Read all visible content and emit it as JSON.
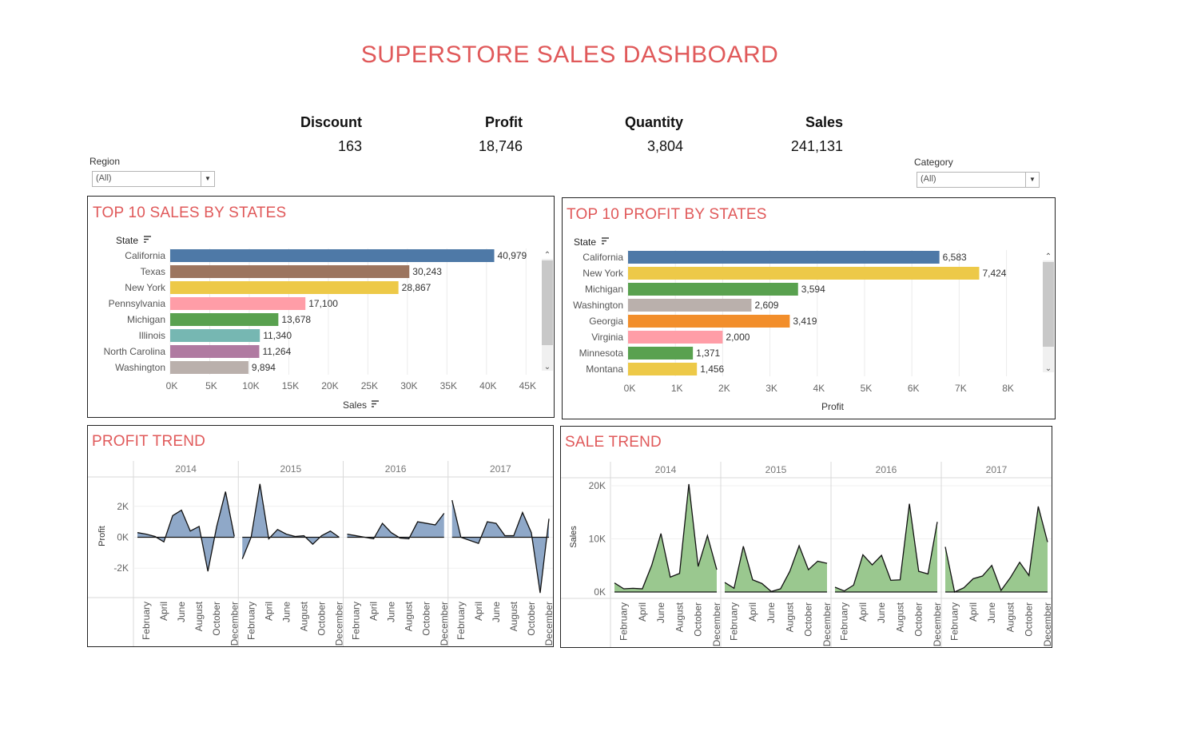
{
  "dashboard": {
    "title": "SUPERSTORE SALES DASHBOARD"
  },
  "kpis": [
    {
      "label": "Discount",
      "value": "163"
    },
    {
      "label": "Profit",
      "value": "18,746"
    },
    {
      "label": "Quantity",
      "value": "3,804"
    },
    {
      "label": "Sales",
      "value": "241,131"
    }
  ],
  "filters": {
    "region": {
      "label": "Region",
      "value": "(All)"
    },
    "category": {
      "label": "Category",
      "value": "(All)"
    }
  },
  "panels": {
    "top_sales": {
      "title": "TOP 10 SALES BY STATES",
      "row_header": "State",
      "axis_title": "Sales"
    },
    "top_profit": {
      "title": "TOP 10 PROFIT BY STATES",
      "row_header": "State",
      "axis_title": "Profit"
    },
    "profit_trend": {
      "title": "PROFIT TREND",
      "axis_title": "Profit"
    },
    "sale_trend": {
      "title": "SALE TREND",
      "axis_title": "Sales"
    }
  },
  "colors": {
    "title": "#e0595a",
    "profit_area": "#8fa8c8",
    "sales_area": "#9ac88f"
  },
  "chart_data": [
    {
      "id": "top_sales",
      "type": "bar",
      "orientation": "horizontal",
      "categories": [
        "California",
        "Texas",
        "New York",
        "Pennsylvania",
        "Michigan",
        "Illinois",
        "North Carolina",
        "Washington"
      ],
      "values": [
        40979,
        30243,
        28867,
        17100,
        13678,
        11340,
        11264,
        9894
      ],
      "labels": [
        "40,979",
        "30,243",
        "28,867",
        "17,100",
        "13,678",
        "11,340",
        "11,264",
        "9,894"
      ],
      "colors": [
        "#4e79a7",
        "#9c755f",
        "#edc948",
        "#ff9da7",
        "#59a14f",
        "#76b7b2",
        "#b07aa1",
        "#bab0ac"
      ],
      "xlabel": "Sales",
      "xlim": [
        0,
        48000
      ],
      "ticks": [
        0,
        5000,
        10000,
        15000,
        20000,
        25000,
        30000,
        35000,
        40000,
        45000
      ],
      "tick_labels": [
        "0K",
        "5K",
        "10K",
        "15K",
        "20K",
        "25K",
        "30K",
        "35K",
        "40K",
        "45K"
      ],
      "grid": true
    },
    {
      "id": "top_profit",
      "type": "bar",
      "orientation": "horizontal",
      "categories": [
        "California",
        "New York",
        "Michigan",
        "Washington",
        "Georgia",
        "Virginia",
        "Minnesota",
        "Montana"
      ],
      "values": [
        6583,
        7424,
        3594,
        2609,
        3419,
        2000,
        1371,
        1456
      ],
      "labels": [
        "6,583",
        "7,424",
        "3,594",
        "2,609",
        "3,419",
        "2,000",
        "1,371",
        "1,456"
      ],
      "colors": [
        "#4e79a7",
        "#edc948",
        "#59a14f",
        "#bab0ac",
        "#f28e2b",
        "#ff9da7",
        "#59a14f",
        "#edc948"
      ],
      "xlabel": "Profit",
      "xlim": [
        0,
        8700
      ],
      "ticks": [
        0,
        1000,
        2000,
        3000,
        4000,
        5000,
        6000,
        7000,
        8000
      ],
      "tick_labels": [
        "0K",
        "1K",
        "2K",
        "3K",
        "4K",
        "5K",
        "6K",
        "7K",
        "8K"
      ],
      "grid": true
    },
    {
      "id": "profit_trend",
      "type": "area",
      "years": [
        "2014",
        "2015",
        "2016",
        "2017"
      ],
      "months_shown": [
        "February",
        "April",
        "June",
        "August",
        "October",
        "December"
      ],
      "ylabel": "Profit",
      "ylim": [
        -3900,
        3900
      ],
      "yticks": [
        -2000,
        0,
        2000
      ],
      "ytick_labels": [
        "-2K",
        "0K",
        "2K"
      ],
      "series": [
        [
          300,
          200,
          50,
          -300,
          1400,
          1750,
          400,
          700,
          -2200,
          700,
          2950,
          50
        ],
        [
          -1400,
          0,
          3450,
          -100,
          500,
          200,
          50,
          100,
          -450,
          100,
          400,
          0
        ],
        [
          200,
          100,
          0,
          -100,
          900,
          300,
          -50,
          -100,
          1000,
          900,
          800,
          1550
        ],
        [
          2400,
          0,
          -200,
          -400,
          1000,
          900,
          100,
          100,
          1600,
          300,
          -3600,
          1200
        ]
      ]
    },
    {
      "id": "sale_trend",
      "type": "area",
      "years": [
        "2014",
        "2015",
        "2016",
        "2017"
      ],
      "months_shown": [
        "February",
        "April",
        "June",
        "August",
        "October",
        "December"
      ],
      "ylabel": "Sales",
      "ylim": [
        -1200,
        21500
      ],
      "yticks": [
        0,
        10000,
        20000
      ],
      "ytick_labels": [
        "0K",
        "10K",
        "20K"
      ],
      "series": [
        [
          1700,
          600,
          700,
          600,
          5000,
          11000,
          2800,
          3500,
          20300,
          4800,
          10600,
          4200
        ],
        [
          1800,
          700,
          8600,
          2300,
          1600,
          100,
          600,
          3900,
          8700,
          4200,
          5800,
          5400
        ],
        [
          900,
          200,
          1300,
          7000,
          5100,
          6900,
          2200,
          2300,
          16600,
          3900,
          3400,
          13200
        ],
        [
          8500,
          0,
          800,
          2500,
          3000,
          5000,
          300,
          2700,
          5600,
          3100,
          16100,
          9400
        ]
      ]
    }
  ]
}
